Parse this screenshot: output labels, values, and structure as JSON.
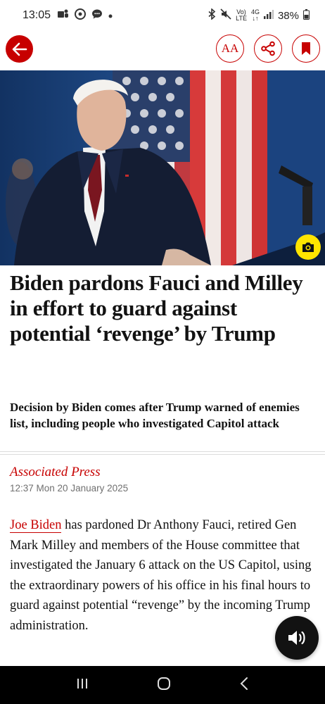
{
  "status_bar": {
    "time": "13:05",
    "battery": "38%",
    "net_top": "Vo)",
    "net_bottom": "LTE",
    "gen_top": "4G",
    "gen_bottom": "↓↑"
  },
  "toolbar": {
    "text_size_label": "AA"
  },
  "article": {
    "headline": "Biden pardons Fauci and Milley in effort to guard against potential ‘revenge’ by Trump",
    "standfirst": "Decision by Biden comes after Trump warned of enemies list, including people who investigated Capitol attack",
    "byline": "Associated Press",
    "dateline": "12:37 Mon 20 January 2025",
    "body_link": "Joe Biden",
    "body_rest": " has pardoned Dr Anthony Fauci, retired Gen Mark Milley and members of the House committee that investigated the January 6 attack on the US Capitol, using the extraordinary powers of his office in his final hours to guard against potential “revenge” by the incoming Trump administration."
  },
  "colors": {
    "accent": "#c70000",
    "camera_badge": "#ffe500",
    "listen_button": "#121212"
  },
  "icons": [
    "back-arrow-icon",
    "text-size-icon",
    "share-icon",
    "bookmark-icon",
    "camera-icon",
    "volume-icon",
    "recents-icon",
    "home-icon",
    "back-icon"
  ]
}
